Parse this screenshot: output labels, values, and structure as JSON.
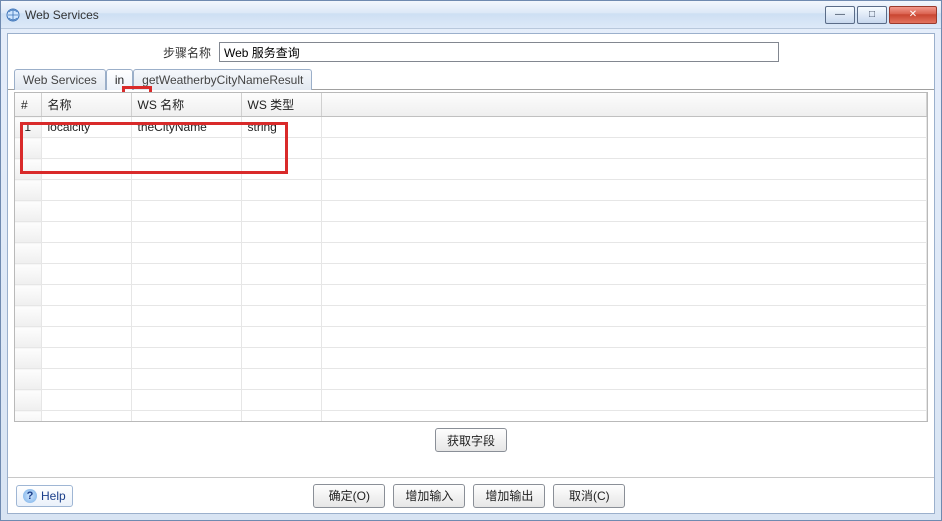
{
  "window": {
    "title": "Web Services",
    "controls": {
      "minimize": "—",
      "maximize": "□",
      "close": "✕"
    }
  },
  "step": {
    "label": "步骤名称",
    "value": "Web 服务查询"
  },
  "tabs": [
    {
      "id": "tab-webservices",
      "label": "Web Services"
    },
    {
      "id": "tab-in",
      "label": "in"
    },
    {
      "id": "tab-result",
      "label": "getWeatherbyCityNameResult"
    }
  ],
  "table": {
    "headers": {
      "idx": "#",
      "name": "名称",
      "wsname": "WS 名称",
      "wstype": "WS 类型"
    },
    "rows": [
      {
        "idx": "1",
        "name": "localcity",
        "wsname": "theCityName",
        "wstype": "string"
      }
    ]
  },
  "buttons": {
    "getFields": "获取字段",
    "ok": "确定(O)",
    "addInput": "增加输入",
    "addOutput": "增加输出",
    "cancel": "取消(C)",
    "help": "Help"
  }
}
